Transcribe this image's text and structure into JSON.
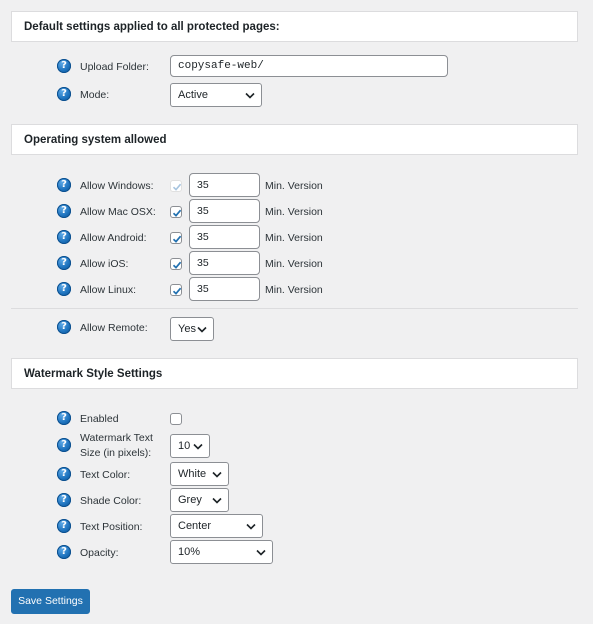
{
  "sections": {
    "defaults_title": "Default settings applied to all protected pages:",
    "os_title": "Operating system allowed",
    "watermark_title": "Watermark Style Settings"
  },
  "help_glyph": "?",
  "defaults": {
    "upload_folder_label": "Upload Folder:",
    "upload_folder_value": "copysafe-web/",
    "mode_label": "Mode:",
    "mode_value": "Active"
  },
  "os": {
    "min_version_label": "Min. Version",
    "windows": {
      "label": "Allow Windows:",
      "checked": true,
      "disabled": true,
      "version": "35"
    },
    "mac": {
      "label": "Allow Mac OSX:",
      "checked": true,
      "version": "35"
    },
    "android": {
      "label": "Allow Android:",
      "checked": true,
      "version": "35"
    },
    "ios": {
      "label": "Allow iOS:",
      "checked": true,
      "version": "35"
    },
    "linux": {
      "label": "Allow Linux:",
      "checked": true,
      "version": "35"
    },
    "remote_label": "Allow Remote:",
    "remote_value": "Yes"
  },
  "watermark": {
    "enabled_label": "Enabled",
    "enabled_checked": false,
    "size_label_line1": "Watermark Text",
    "size_label_line2": "Size (in pixels):",
    "size_value": "10",
    "text_color_label": "Text Color:",
    "text_color_value": "White",
    "shade_color_label": "Shade Color:",
    "shade_color_value": "Grey",
    "position_label": "Text Position:",
    "position_value": "Center",
    "opacity_label": "Opacity:",
    "opacity_value": "10%"
  },
  "save_button": "Save Settings",
  "colors": {
    "accent": "#2271b1",
    "background": "#f0f0f1",
    "panel": "#ffffff",
    "check": "#2271b1"
  },
  "icons": {
    "help": "help-icon",
    "chevron": "chevron-down-icon",
    "check": "check-icon"
  }
}
